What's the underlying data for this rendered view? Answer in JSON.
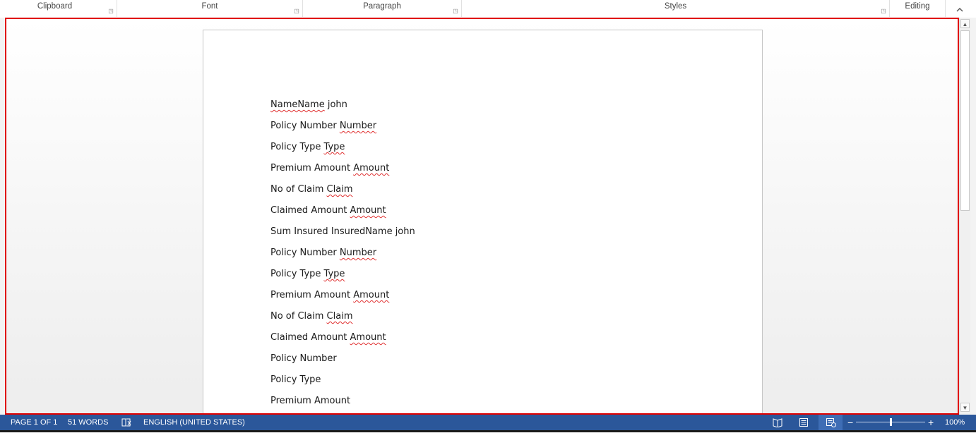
{
  "ribbon": {
    "groups": [
      {
        "label": "Clipboard"
      },
      {
        "label": "Font"
      },
      {
        "label": "Paragraph"
      },
      {
        "label": "Styles"
      },
      {
        "label": "Editing"
      }
    ],
    "collapse_icon": "chevron-up-icon"
  },
  "document": {
    "lines": [
      {
        "plain": "NameName john",
        "squiggle": "NameName",
        "tail": " john",
        "mode": "head"
      },
      {
        "plain": "Policy Number ",
        "squiggle": "Number"
      },
      {
        "plain": "Policy Type ",
        "squiggle": "Type"
      },
      {
        "plain": "Premium Amount ",
        "squiggle": "Amount"
      },
      {
        "plain": "No of Claim ",
        "squiggle": "Claim"
      },
      {
        "plain": "Claimed Amount ",
        "squiggle": "Amount"
      },
      {
        "plain": "Sum Insured InsuredName john",
        "squiggle": ""
      },
      {
        "plain": "Policy Number ",
        "squiggle": "Number"
      },
      {
        "plain": "Policy Type ",
        "squiggle": "Type"
      },
      {
        "plain": "Premium Amount ",
        "squiggle": "Amount"
      },
      {
        "plain": "No of Claim ",
        "squiggle": "Claim"
      },
      {
        "plain": "Claimed Amount ",
        "squiggle": "Amount"
      },
      {
        "plain": "Policy Number",
        "squiggle": ""
      },
      {
        "plain": "Policy Type",
        "squiggle": ""
      },
      {
        "plain": "Premium Amount",
        "squiggle": ""
      }
    ]
  },
  "statusbar": {
    "page": "PAGE 1 OF 1",
    "words": "51 WORDS",
    "proofing_icon": "proofing-book-icon",
    "language": "ENGLISH (UNITED STATES)",
    "view_icons": [
      "read-mode-icon",
      "print-layout-icon",
      "web-layout-icon"
    ],
    "zoom_out": "−",
    "zoom_in": "+",
    "zoom": "100%",
    "zoom_level": 0.5
  },
  "colors": {
    "statusbar_bg": "#2b579a",
    "selection_border": "#e00000",
    "spell_squiggle": "#e03030"
  }
}
